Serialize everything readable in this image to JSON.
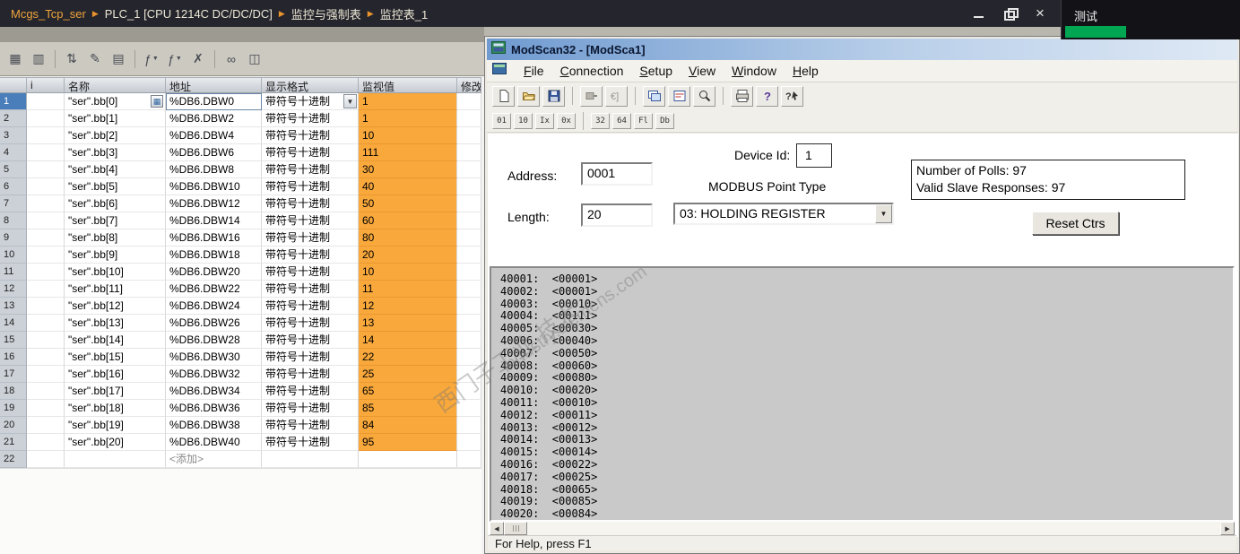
{
  "tia": {
    "breadcrumb": {
      "project": "Mcgs_Tcp_ser",
      "separator": "▶",
      "items": [
        "PLC_1 [CPU 1214C DC/DC/DC]",
        "监控与强制表",
        "监控表_1"
      ]
    },
    "side_tab": "测试",
    "toolbar_icons": [
      "watch-all-icon",
      "watch-once-icon",
      "sort-rows-icon",
      "edit-table-icon",
      "list-icon",
      "modify-now-icon",
      "modify-trigger-icon",
      "stop-modify-icon",
      "show-force-icon",
      "show-watch-icon"
    ],
    "table": {
      "headers": [
        "i",
        "名称",
        "地址",
        "显示格式",
        "监视值",
        "修改"
      ],
      "format_text": "带符号十进制",
      "add_label": "<添加>",
      "add_row_number": "22",
      "rows": [
        {
          "n": "1",
          "name": "\"ser\".bb[0]",
          "addr": "%DB6.DBW0",
          "value": "1"
        },
        {
          "n": "2",
          "name": "\"ser\".bb[1]",
          "addr": "%DB6.DBW2",
          "value": "1"
        },
        {
          "n": "3",
          "name": "\"ser\".bb[2]",
          "addr": "%DB6.DBW4",
          "value": "10"
        },
        {
          "n": "4",
          "name": "\"ser\".bb[3]",
          "addr": "%DB6.DBW6",
          "value": "111"
        },
        {
          "n": "5",
          "name": "\"ser\".bb[4]",
          "addr": "%DB6.DBW8",
          "value": "30"
        },
        {
          "n": "6",
          "name": "\"ser\".bb[5]",
          "addr": "%DB6.DBW10",
          "value": "40"
        },
        {
          "n": "7",
          "name": "\"ser\".bb[6]",
          "addr": "%DB6.DBW12",
          "value": "50"
        },
        {
          "n": "8",
          "name": "\"ser\".bb[7]",
          "addr": "%DB6.DBW14",
          "value": "60"
        },
        {
          "n": "9",
          "name": "\"ser\".bb[8]",
          "addr": "%DB6.DBW16",
          "value": "80"
        },
        {
          "n": "10",
          "name": "\"ser\".bb[9]",
          "addr": "%DB6.DBW18",
          "value": "20"
        },
        {
          "n": "11",
          "name": "\"ser\".bb[10]",
          "addr": "%DB6.DBW20",
          "value": "10"
        },
        {
          "n": "12",
          "name": "\"ser\".bb[11]",
          "addr": "%DB6.DBW22",
          "value": "11"
        },
        {
          "n": "13",
          "name": "\"ser\".bb[12]",
          "addr": "%DB6.DBW24",
          "value": "12"
        },
        {
          "n": "14",
          "name": "\"ser\".bb[13]",
          "addr": "%DB6.DBW26",
          "value": "13"
        },
        {
          "n": "15",
          "name": "\"ser\".bb[14]",
          "addr": "%DB6.DBW28",
          "value": "14"
        },
        {
          "n": "16",
          "name": "\"ser\".bb[15]",
          "addr": "%DB6.DBW30",
          "value": "22"
        },
        {
          "n": "17",
          "name": "\"ser\".bb[16]",
          "addr": "%DB6.DBW32",
          "value": "25"
        },
        {
          "n": "18",
          "name": "\"ser\".bb[17]",
          "addr": "%DB6.DBW34",
          "value": "65"
        },
        {
          "n": "19",
          "name": "\"ser\".bb[18]",
          "addr": "%DB6.DBW36",
          "value": "85"
        },
        {
          "n": "20",
          "name": "\"ser\".bb[19]",
          "addr": "%DB6.DBW38",
          "value": "84"
        },
        {
          "n": "21",
          "name": "\"ser\".bb[20]",
          "addr": "%DB6.DBW40",
          "value": "95"
        }
      ]
    },
    "colors": {
      "value_highlight": "#F9A83C",
      "breadcrumb_project": "#EEA43C"
    }
  },
  "modscan": {
    "title": "ModScan32 - [ModSca1]",
    "title_icon": "modscan-app-icon",
    "menu": [
      "File",
      "Connection",
      "Setup",
      "View",
      "Window",
      "Help"
    ],
    "toolbar_main": [
      "new-file-icon",
      "open-file-icon",
      "save-icon",
      "connect-icon",
      "disconnect-icon",
      "display-window-icon",
      "traffic-window-icon",
      "zoom-icon",
      "print-icon",
      "help-icon",
      "context-help-icon"
    ],
    "toolbar_format": [
      "01",
      "10",
      "Ix",
      "0x",
      "32",
      "64",
      "Fl",
      "Db"
    ],
    "fields": {
      "address_label": "Address:",
      "address_value": "0001",
      "length_label": "Length:",
      "length_value": "20",
      "device_id_label": "Device Id:",
      "device_id_value": "1",
      "point_type_label": "MODBUS Point Type",
      "point_type_value": "03: HOLDING REGISTER",
      "polls_line1": "Number of Polls: 97",
      "polls_line2": "Valid Slave Responses: 97",
      "reset_button": "Reset Ctrs"
    },
    "registers": [
      "40001:  <00001>",
      "40002:  <00001>",
      "40003:  <00010>",
      "40004:  <00111>",
      "40005:  <00030>",
      "40006:  <00040>",
      "40007:  <00050>",
      "40008:  <00060>",
      "40009:  <00080>",
      "40010:  <00020>",
      "40011:  <00010>",
      "40012:  <00011>",
      "40013:  <00012>",
      "40014:  <00013>",
      "40015:  <00014>",
      "40016:  <00022>",
      "40017:  <00025>",
      "40018:  <00065>",
      "40019:  <00085>",
      "40020:  <00084>"
    ],
    "status_bar": "For Help, press F1"
  },
  "watermark": {
    "line1": "西门子工业 技术",
    "line2": "industry.siemens.com"
  }
}
